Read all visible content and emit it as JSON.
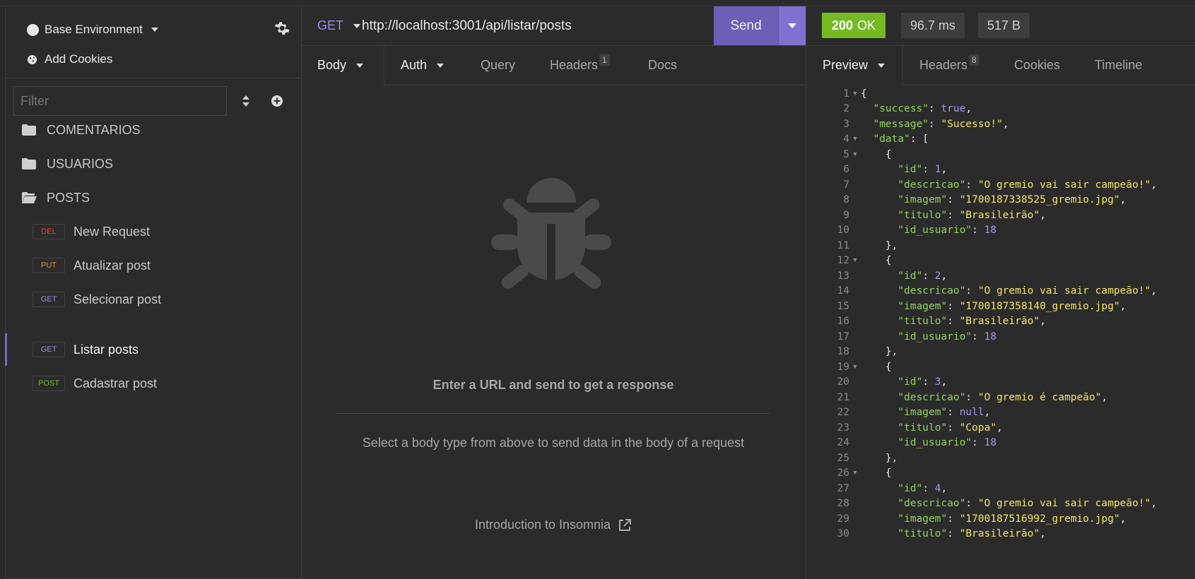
{
  "sidebar": {
    "environment": "Base Environment",
    "add_cookies": "Add Cookies",
    "filter_placeholder": "Filter",
    "folders": [
      {
        "label": "COMENTARIOS"
      },
      {
        "label": "USUARIOS"
      },
      {
        "label": "POSTS"
      }
    ],
    "requests": [
      {
        "method": "DEL",
        "label": "New Request",
        "color": "#e6452d"
      },
      {
        "method": "PUT",
        "label": "Atualizar post",
        "color": "#ef8a34"
      },
      {
        "method": "GET",
        "label": "Selecionar post",
        "color": "#9b8de8"
      },
      {
        "method": "GET",
        "label": "Listar posts",
        "color": "#9b8de8"
      },
      {
        "method": "POST",
        "label": "Cadastrar post",
        "color": "#75ba24"
      }
    ]
  },
  "urlbar": {
    "method": "GET",
    "url": "http://localhost:3001/api/listar/posts",
    "send_label": "Send"
  },
  "request_tabs": {
    "body": "Body",
    "auth": "Auth",
    "query": "Query",
    "headers": "Headers",
    "headers_count": "1",
    "docs": "Docs"
  },
  "request_body": {
    "empty_title": "Enter a URL and send to get a response",
    "empty_sub": "Select a body type from above to send data in the body of a request",
    "intro_link": "Introduction to Insomnia"
  },
  "response": {
    "status_code": "200",
    "status_text": "OK",
    "time": "96.7 ms",
    "size": "517 B",
    "tabs": {
      "preview": "Preview",
      "headers": "Headers",
      "headers_count": "8",
      "cookies": "Cookies",
      "timeline": "Timeline"
    }
  },
  "colors": {
    "accent": "#7d69cb",
    "status_ok": "#75ba24",
    "json_key": "#90d458",
    "json_string": "#f4e45c",
    "json_number": "#a794f0"
  },
  "code_lines": [
    {
      "n": "1",
      "fold": true,
      "t": [
        [
          "txt",
          "{"
        ]
      ]
    },
    {
      "n": "2",
      "t": [
        [
          "txt",
          "  "
        ],
        [
          "k",
          "\"success\""
        ],
        [
          "txt",
          ": "
        ],
        [
          "b",
          "true"
        ],
        [
          "txt",
          ","
        ]
      ]
    },
    {
      "n": "3",
      "t": [
        [
          "txt",
          "  "
        ],
        [
          "k",
          "\"message\""
        ],
        [
          "txt",
          ": "
        ],
        [
          "s",
          "\"Sucesso!\""
        ],
        [
          "txt",
          ","
        ]
      ]
    },
    {
      "n": "4",
      "fold": true,
      "t": [
        [
          "txt",
          "  "
        ],
        [
          "k",
          "\"data\""
        ],
        [
          "txt",
          ": ["
        ]
      ]
    },
    {
      "n": "5",
      "fold": true,
      "t": [
        [
          "txt",
          "    {"
        ]
      ]
    },
    {
      "n": "6",
      "t": [
        [
          "txt",
          "      "
        ],
        [
          "k",
          "\"id\""
        ],
        [
          "txt",
          ": "
        ],
        [
          "n",
          "1"
        ],
        [
          "txt",
          ","
        ]
      ]
    },
    {
      "n": "7",
      "t": [
        [
          "txt",
          "      "
        ],
        [
          "k",
          "\"descricao\""
        ],
        [
          "txt",
          ": "
        ],
        [
          "s",
          "\"O gremio vai sair campeão!\""
        ],
        [
          "txt",
          ","
        ]
      ]
    },
    {
      "n": "8",
      "t": [
        [
          "txt",
          "      "
        ],
        [
          "k",
          "\"imagem\""
        ],
        [
          "txt",
          ": "
        ],
        [
          "s",
          "\"1700187338525_gremio.jpg\""
        ],
        [
          "txt",
          ","
        ]
      ]
    },
    {
      "n": "9",
      "t": [
        [
          "txt",
          "      "
        ],
        [
          "k",
          "\"titulo\""
        ],
        [
          "txt",
          ": "
        ],
        [
          "s",
          "\"Brasileirão\""
        ],
        [
          "txt",
          ","
        ]
      ]
    },
    {
      "n": "10",
      "t": [
        [
          "txt",
          "      "
        ],
        [
          "k",
          "\"id_usuario\""
        ],
        [
          "txt",
          ": "
        ],
        [
          "n",
          "18"
        ]
      ]
    },
    {
      "n": "11",
      "t": [
        [
          "txt",
          "    },"
        ]
      ]
    },
    {
      "n": "12",
      "fold": true,
      "t": [
        [
          "txt",
          "    {"
        ]
      ]
    },
    {
      "n": "13",
      "t": [
        [
          "txt",
          "      "
        ],
        [
          "k",
          "\"id\""
        ],
        [
          "txt",
          ": "
        ],
        [
          "n",
          "2"
        ],
        [
          "txt",
          ","
        ]
      ]
    },
    {
      "n": "14",
      "t": [
        [
          "txt",
          "      "
        ],
        [
          "k",
          "\"descricao\""
        ],
        [
          "txt",
          ": "
        ],
        [
          "s",
          "\"O gremio vai sair campeão!\""
        ],
        [
          "txt",
          ","
        ]
      ]
    },
    {
      "n": "15",
      "t": [
        [
          "txt",
          "      "
        ],
        [
          "k",
          "\"imagem\""
        ],
        [
          "txt",
          ": "
        ],
        [
          "s",
          "\"1700187358140_gremio.jpg\""
        ],
        [
          "txt",
          ","
        ]
      ]
    },
    {
      "n": "16",
      "t": [
        [
          "txt",
          "      "
        ],
        [
          "k",
          "\"titulo\""
        ],
        [
          "txt",
          ": "
        ],
        [
          "s",
          "\"Brasileirão\""
        ],
        [
          "txt",
          ","
        ]
      ]
    },
    {
      "n": "17",
      "t": [
        [
          "txt",
          "      "
        ],
        [
          "k",
          "\"id_usuario\""
        ],
        [
          "txt",
          ": "
        ],
        [
          "n",
          "18"
        ]
      ]
    },
    {
      "n": "18",
      "t": [
        [
          "txt",
          "    },"
        ]
      ]
    },
    {
      "n": "19",
      "fold": true,
      "t": [
        [
          "txt",
          "    {"
        ]
      ]
    },
    {
      "n": "20",
      "t": [
        [
          "txt",
          "      "
        ],
        [
          "k",
          "\"id\""
        ],
        [
          "txt",
          ": "
        ],
        [
          "n",
          "3"
        ],
        [
          "txt",
          ","
        ]
      ]
    },
    {
      "n": "21",
      "t": [
        [
          "txt",
          "      "
        ],
        [
          "k",
          "\"descricao\""
        ],
        [
          "txt",
          ": "
        ],
        [
          "s",
          "\"O gremio é campeão\""
        ],
        [
          "txt",
          ","
        ]
      ]
    },
    {
      "n": "22",
      "t": [
        [
          "txt",
          "      "
        ],
        [
          "k",
          "\"imagem\""
        ],
        [
          "txt",
          ": "
        ],
        [
          "b",
          "null"
        ],
        [
          "txt",
          ","
        ]
      ]
    },
    {
      "n": "23",
      "t": [
        [
          "txt",
          "      "
        ],
        [
          "k",
          "\"titulo\""
        ],
        [
          "txt",
          ": "
        ],
        [
          "s",
          "\"Copa\""
        ],
        [
          "txt",
          ","
        ]
      ]
    },
    {
      "n": "24",
      "t": [
        [
          "txt",
          "      "
        ],
        [
          "k",
          "\"id_usuario\""
        ],
        [
          "txt",
          ": "
        ],
        [
          "n",
          "18"
        ]
      ]
    },
    {
      "n": "25",
      "t": [
        [
          "txt",
          "    },"
        ]
      ]
    },
    {
      "n": "26",
      "fold": true,
      "t": [
        [
          "txt",
          "    {"
        ]
      ]
    },
    {
      "n": "27",
      "t": [
        [
          "txt",
          "      "
        ],
        [
          "k",
          "\"id\""
        ],
        [
          "txt",
          ": "
        ],
        [
          "n",
          "4"
        ],
        [
          "txt",
          ","
        ]
      ]
    },
    {
      "n": "28",
      "t": [
        [
          "txt",
          "      "
        ],
        [
          "k",
          "\"descricao\""
        ],
        [
          "txt",
          ": "
        ],
        [
          "s",
          "\"O gremio vai sair campeão!\""
        ],
        [
          "txt",
          ","
        ]
      ]
    },
    {
      "n": "29",
      "t": [
        [
          "txt",
          "      "
        ],
        [
          "k",
          "\"imagem\""
        ],
        [
          "txt",
          ": "
        ],
        [
          "s",
          "\"1700187516992_gremio.jpg\""
        ],
        [
          "txt",
          ","
        ]
      ]
    },
    {
      "n": "30",
      "t": [
        [
          "txt",
          "      "
        ],
        [
          "k",
          "\"titulo\""
        ],
        [
          "txt",
          ": "
        ],
        [
          "s",
          "\"Brasileirão\""
        ],
        [
          "txt",
          ","
        ]
      ]
    }
  ]
}
